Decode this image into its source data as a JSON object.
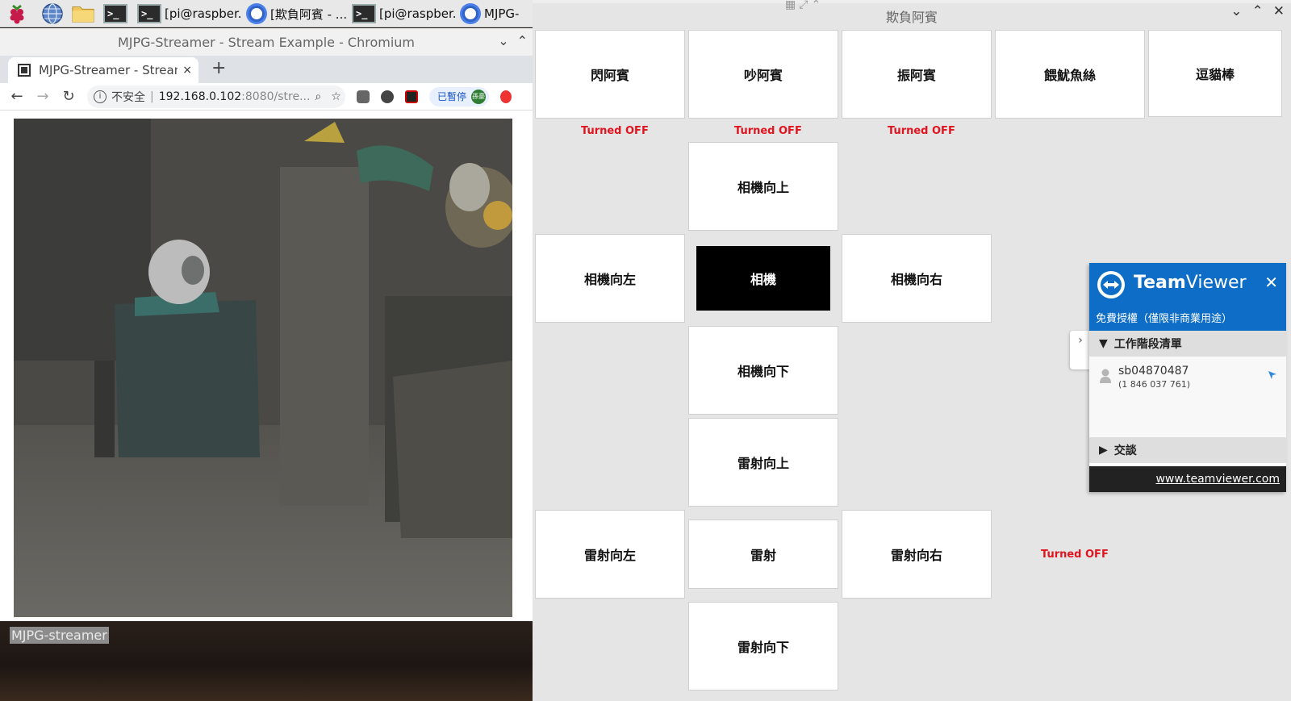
{
  "taskbar": {
    "tasks": [
      {
        "label": "[pi@raspber...",
        "kind": "terminal"
      },
      {
        "label": "[欺負阿賓 - ...",
        "kind": "chromium"
      },
      {
        "label": "[pi@raspber...",
        "kind": "terminal"
      },
      {
        "label": "MJPG-",
        "kind": "chromium"
      }
    ]
  },
  "chromium": {
    "window_title": "MJPG-Streamer - Stream Example - Chromium",
    "tab_title": "MJPG-Streamer - Stream Example",
    "tab_close": "×",
    "new_tab": "+",
    "omnibox": {
      "security": "不安全",
      "url_host": "192.168.0.102",
      "url_rest": ":8080/stre..."
    },
    "profile_status": "已暫停",
    "profile_avatar": "孫豪",
    "stream_label": "MJPG-streamer"
  },
  "controller": {
    "window_title": "欺負阿賓",
    "buttons": {
      "flash": "閃阿賓",
      "noise": "吵阿賓",
      "vibrate": "振阿賓",
      "feed": "餵魷魚絲",
      "tease": "逗貓棒",
      "cam_up": "相機向上",
      "cam_left": "相機向左",
      "cam": "相機",
      "cam_right": "相機向右",
      "cam_down": "相機向下",
      "laser_up": "雷射向上",
      "laser_left": "雷射向左",
      "laser": "雷射",
      "laser_right": "雷射向右",
      "laser_down": "雷射向下"
    },
    "status": {
      "flash": "Turned OFF",
      "noise": "Turned OFF",
      "vibrate": "Turned OFF",
      "laser": "Turned OFF"
    },
    "active_button": "cam"
  },
  "teamviewer": {
    "brand_bold": "Team",
    "brand_light": "Viewer",
    "license": "免費授權（僅限非商業用途）",
    "sessions_header": "工作階段清單",
    "session_name": "sb04870487",
    "session_id": "(1 846 037 761)",
    "chat_header": "交談",
    "link": "www.teamviewer.com"
  },
  "colors": {
    "status_red": "#e0141e",
    "teamviewer_blue": "#0e6ec7",
    "active_button_bg": "#000000"
  }
}
